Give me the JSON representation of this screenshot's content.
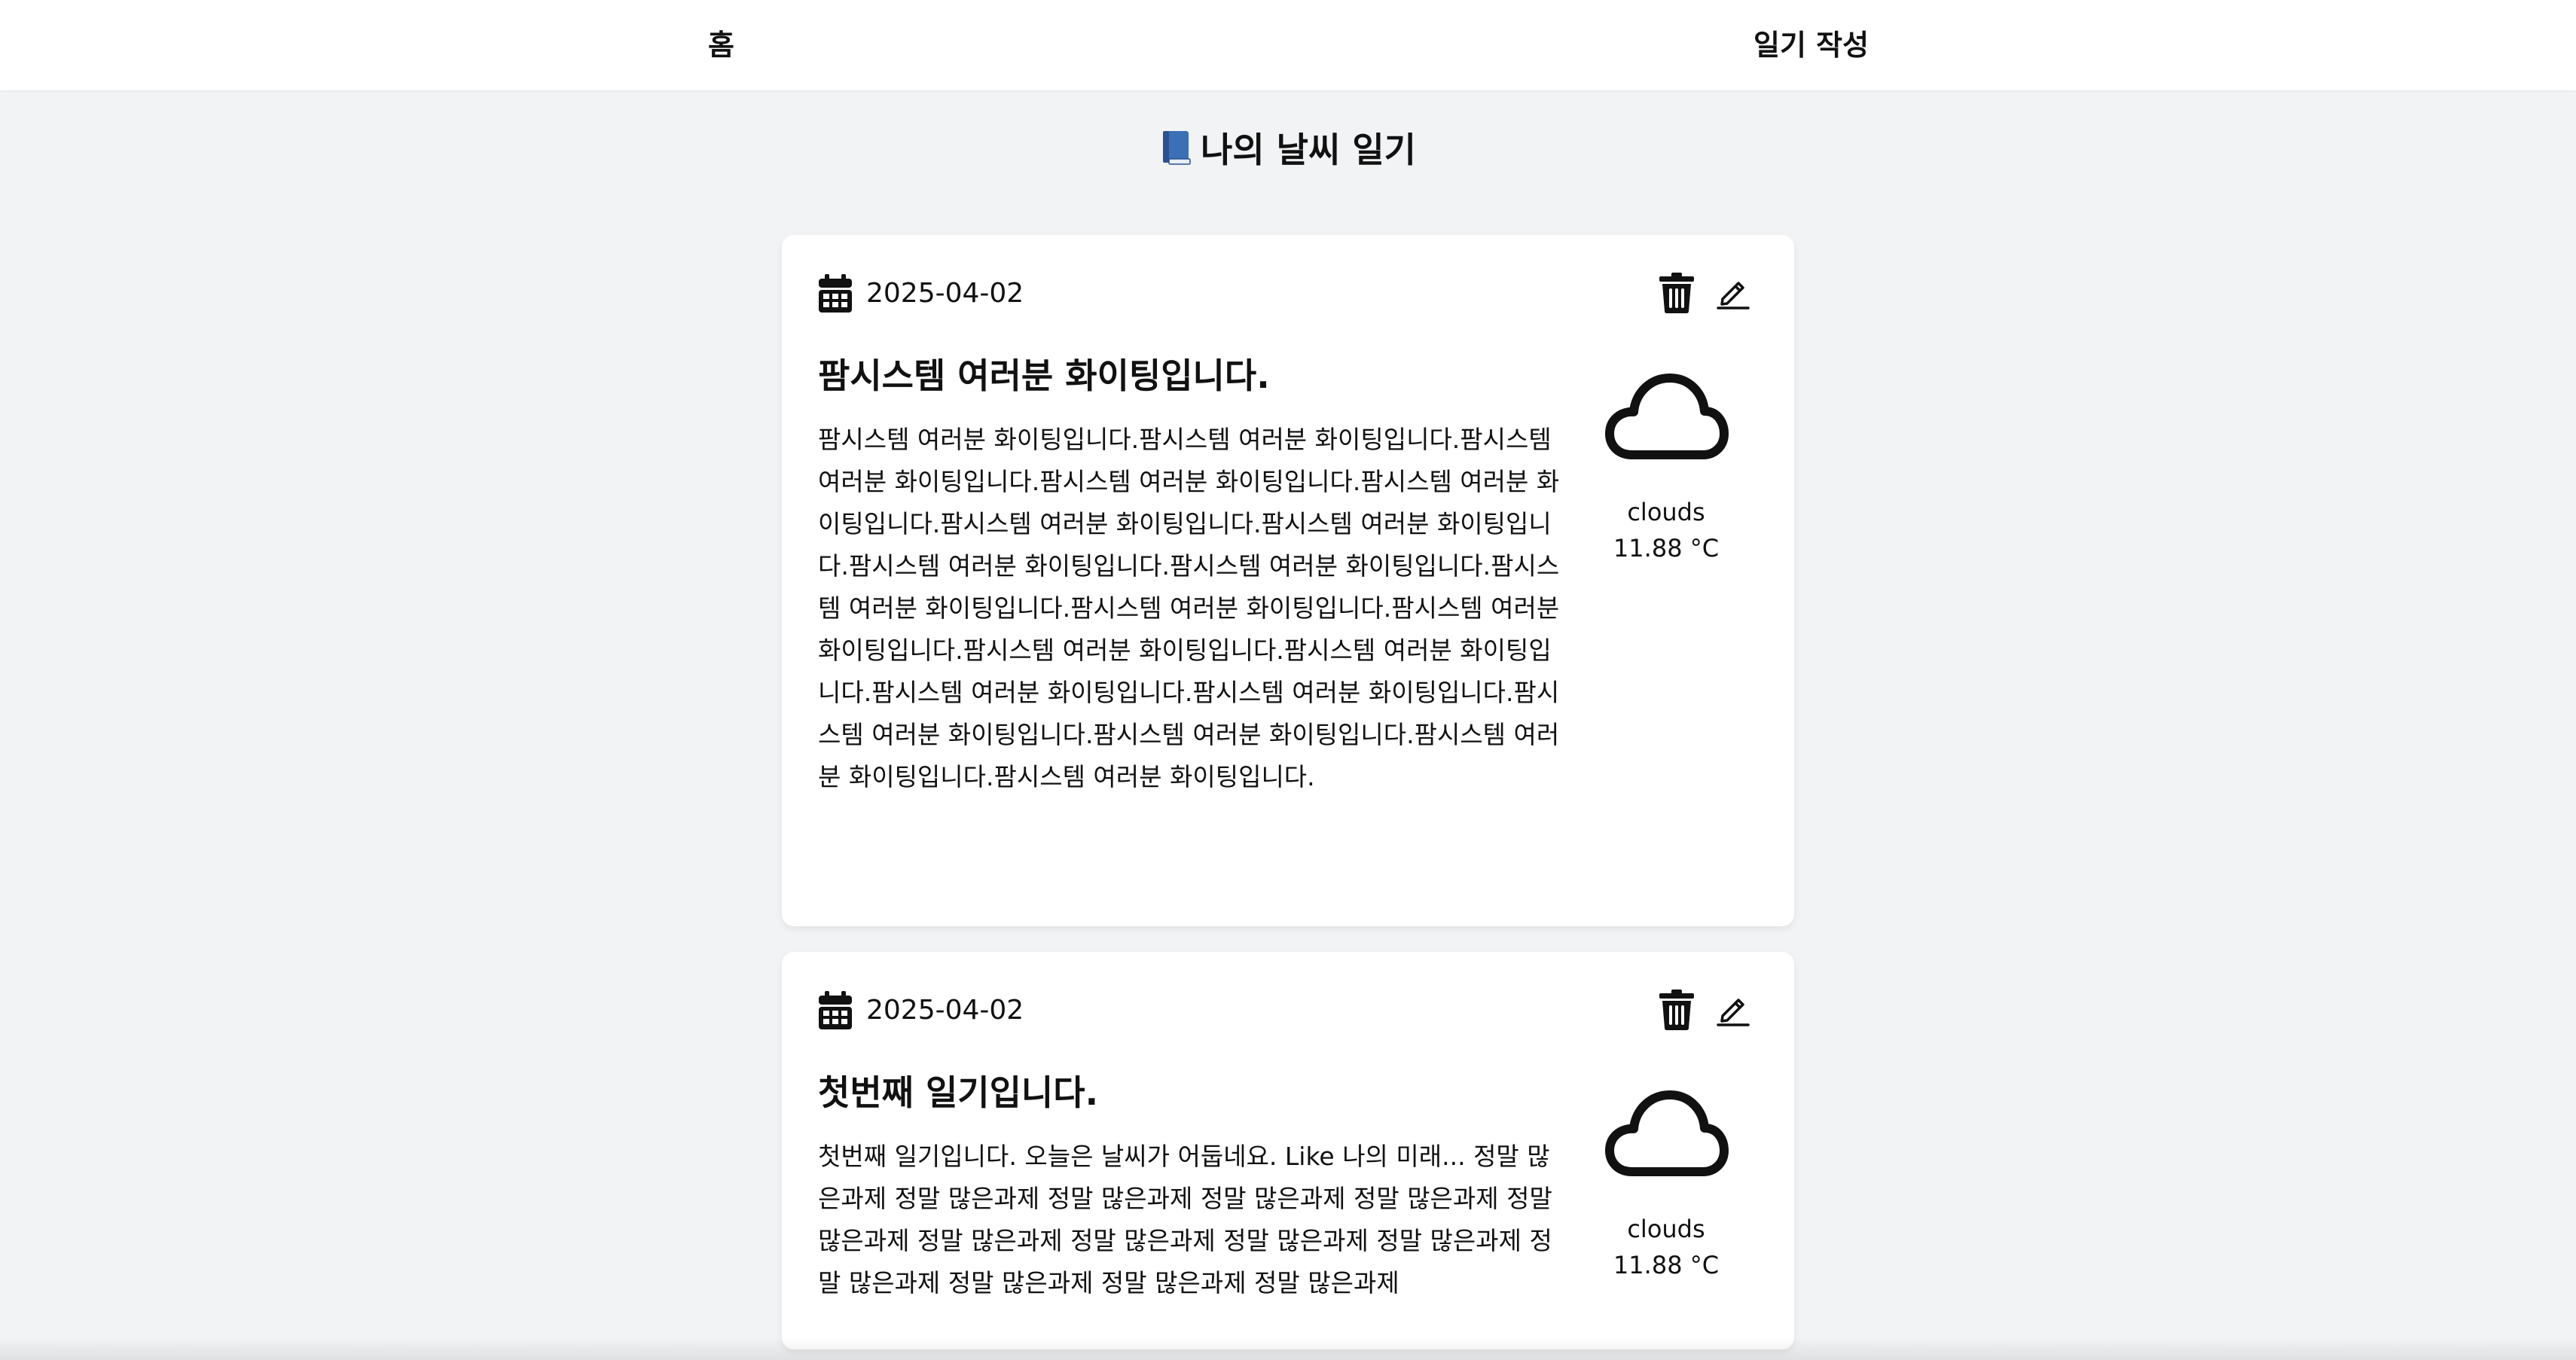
{
  "nav": {
    "home": "홈",
    "write": "일기 작성"
  },
  "page": {
    "title": "나의 날씨 일기",
    "title_icon": "blue-book-icon"
  },
  "entries": [
    {
      "date": "2025-04-02",
      "title": "팜시스템 여러분 화이팅입니다.",
      "content": "팜시스템 여러분 화이팅입니다.팜시스템 여러분 화이팅입니다.팜시스템 여러분 화이팅입니다.팜시스템 여러분 화이팅입니다.팜시스템 여러분 화이팅입니다.팜시스템 여러분 화이팅입니다.팜시스템 여러분 화이팅입니다.팜시스템 여러분 화이팅입니다.팜시스템 여러분 화이팅입니다.팜시스템 여러분 화이팅입니다.팜시스템 여러분 화이팅입니다.팜시스템 여러분 화이팅입니다.팜시스템 여러분 화이팅입니다.팜시스템 여러분 화이팅입니다.팜시스템 여러분 화이팅입니다.팜시스템 여러분 화이팅입니다.팜시스템 여러분 화이팅입니다.팜시스템 여러분 화이팅입니다.팜시스템 여러분 화이팅입니다.팜시스템 여러분 화이팅입니다.",
      "weather": "clouds",
      "temperature": "11.88 °C",
      "weather_icon": "cloud-icon"
    },
    {
      "date": "2025-04-02",
      "title": "첫번째 일기입니다.",
      "content": "첫번째 일기입니다. 오늘은 날씨가 어둡네요. Like 나의 미래... 정말 많은과제 정말 많은과제 정말 많은과제 정말 많은과제 정말 많은과제 정말 많은과제 정말 많은과제 정말 많은과제 정말 많은과제 정말 많은과제 정말 많은과제 정말 많은과제 정말 많은과제 정말 많은과제",
      "weather": "clouds",
      "temperature": "11.88 °C",
      "weather_icon": "cloud-icon"
    }
  ],
  "icons": {
    "calendar": "calendar-icon",
    "delete": "trash-icon",
    "edit": "pencil-icon"
  },
  "colors": {
    "background": "#f2f3f5",
    "card": "#ffffff",
    "text": "#111111",
    "book_blue": "#3b6fb6"
  }
}
